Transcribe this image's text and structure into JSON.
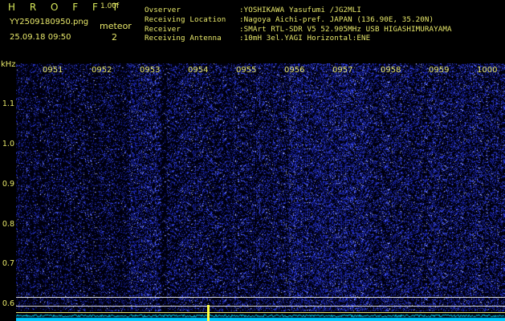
{
  "header": {
    "app_name": "H R O F F T",
    "version": "1.00f",
    "filename": "YY2509180950.png",
    "datetime": "25.09.18 09:50",
    "meteor_label": "meteor",
    "meteor_count": "2",
    "info": [
      {
        "key": "Ovserver",
        "value": ":YOSHIKAWA Yasufumi /JG2MLI"
      },
      {
        "key": "Receiving Location",
        "value": ":Nagoya Aichi-pref. JAPAN (136.90E, 35.20N)"
      },
      {
        "key": "Receiver",
        "value": ":SMArt RTL-SDR V5 52.905MHz USB HIGASHIMURAYAMA"
      },
      {
        "key": "Receiving Antenna",
        "value": ":10mH 3el.YAGI Horizontal:ENE"
      }
    ]
  },
  "plot": {
    "y_unit": "kHz",
    "y_ticks": [
      "1.1",
      "1.0",
      "0.9",
      "0.8",
      "0.7",
      "0.6"
    ],
    "time_labels": [
      "0951",
      "0952",
      "0953",
      "0954",
      "0955",
      "0956",
      "0957",
      "0958",
      "0959",
      "1000"
    ],
    "colors": {
      "text": "#e8e86a",
      "noise_dot": "#3a4cff",
      "noise_bright": "#c8d0ff",
      "spectrum_line": "#00e0ff",
      "meteor": "#ffff40",
      "ref_line_white": "#d8d8d8",
      "ref_line_yellow": "#e8e86a"
    }
  }
}
